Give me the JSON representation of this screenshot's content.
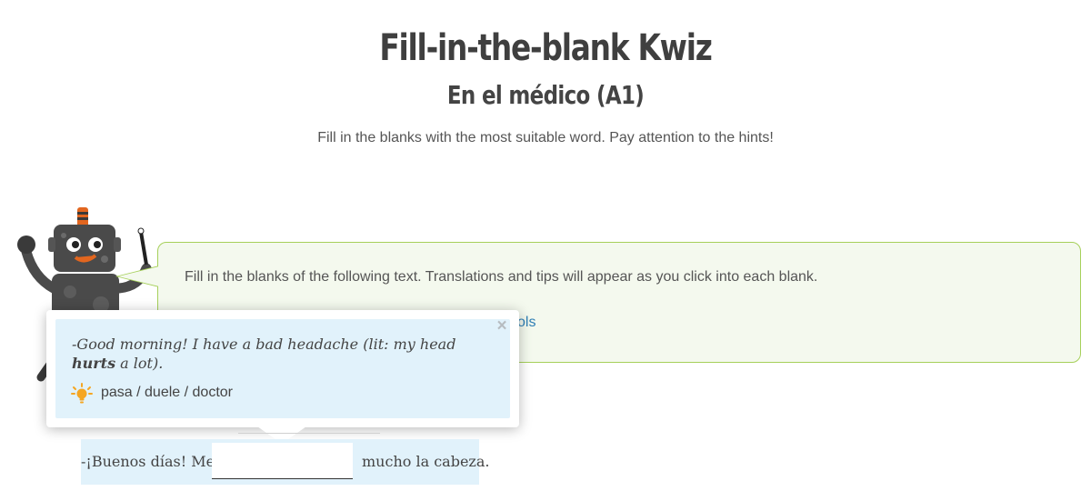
{
  "header": {
    "title": "Fill-in-the-blank Kwiz",
    "subtitle": "En el médico (A1)",
    "instructions": "Fill in the blanks with the most suitable word. Pay attention to the hints!"
  },
  "speech": {
    "text": "Fill in the blanks of the following text. Translations and tips will appear as you click into each blank.",
    "link_visible_text": "ols"
  },
  "popup": {
    "translation_prefix": "-Good morning! I have a bad headache (lit: my head ",
    "translation_bold": "hurts",
    "translation_suffix": " a lot).",
    "hint_options": "pasa / duele / doctor",
    "close_label": "×",
    "hint_icon": "lightbulb-icon"
  },
  "exercise": {
    "before_blank": "-¡Buenos días! Me",
    "blank_value": "",
    "after_blank": "mucho la cabeza."
  },
  "colors": {
    "speech_bg": "#f4f9ee",
    "speech_border": "#a6d05a",
    "popup_bg": "#e1f2fb",
    "link": "#2f7fb5",
    "bulb": "#f5a623"
  }
}
